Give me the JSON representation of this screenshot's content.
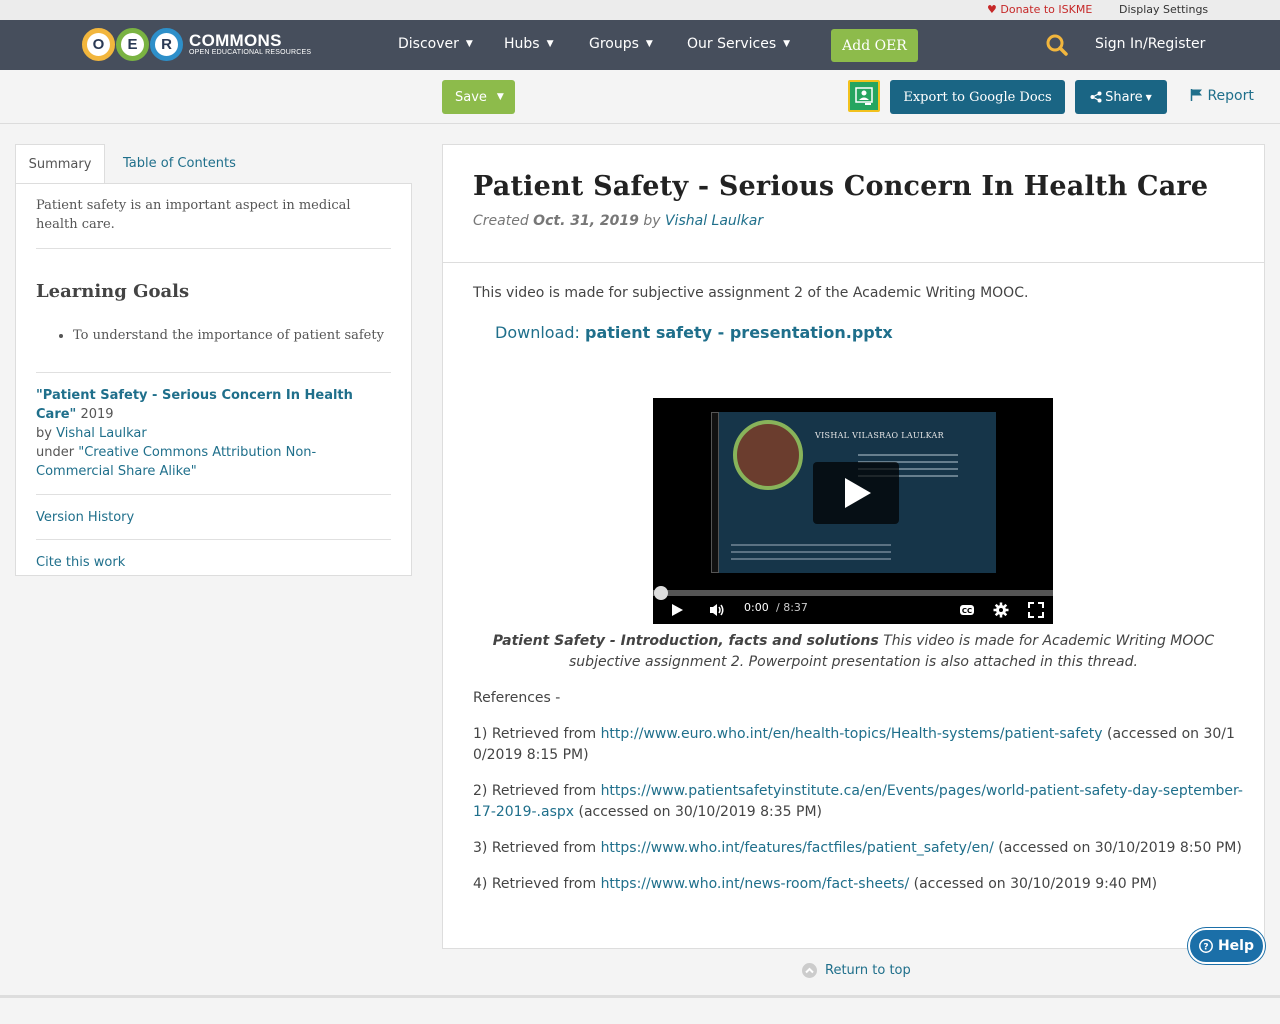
{
  "topbar": {
    "donate": "Donate to ISKME",
    "display_settings": "Display Settings"
  },
  "logo": {
    "letters": [
      "O",
      "E",
      "R"
    ],
    "name": "COMMONS",
    "tagline": "OPEN EDUCATIONAL RESOURCES"
  },
  "nav": {
    "items": [
      {
        "label": "Discover"
      },
      {
        "label": "Hubs"
      },
      {
        "label": "Groups"
      },
      {
        "label": "Our Services"
      }
    ],
    "add_oer": "Add OER",
    "sign_in": "Sign In/Register"
  },
  "toolbar": {
    "save": "Save",
    "export": "Export to Google Docs",
    "share": "Share",
    "report": "Report"
  },
  "sidebar": {
    "tabs": [
      "Summary",
      "Table of Contents"
    ],
    "summary": "Patient safety is an important aspect in medical health care.",
    "learning_goals_title": "Learning Goals",
    "learning_goals": [
      "To understand the importance of patient safety"
    ],
    "attribution": {
      "title": "\"Patient Safety - Serious Concern In Health Care\"",
      "year": "2019",
      "by": "by",
      "author": "Vishal Laulkar",
      "under": "under",
      "license": "\"Creative Commons Attribution Non-Commercial Share Alike\""
    },
    "version_history": "Version History",
    "cite": "Cite this work"
  },
  "main": {
    "title": "Patient Safety - Serious Concern In Health Care",
    "created_label": "Created",
    "created_date": "Oct. 31, 2019",
    "by": "by",
    "author": "Vishal Laulkar",
    "intro": "This video is made for subjective assignment 2 of the Academic Writing MOOC.",
    "download_label": "Download:",
    "download_file": "patient safety - presentation.pptx",
    "video": {
      "slide_name": "VISHAL VILASRAO LAULKAR",
      "time_current": "0:00",
      "time_total": "/ 8:37"
    },
    "caption_bold": "Patient Safety - Introduction, facts and solutions",
    "caption_rest": "This video is made for Academic Writing MOOC subjective assignment 2. Powerpoint presentation is also attached in this thread.",
    "references_title": "References -",
    "references": [
      {
        "prefix": "1) Retrieved from",
        "url": "http://www.euro.who.int/en/health-topics/Health-systems/patient-safety",
        "suffix": "(accessed on 30/10/2019 8:15 PM)"
      },
      {
        "prefix": "2) Retrieved from",
        "url": "https://www.patientsafetyinstitute.ca/en/Events/pages/world-patient-safety-day-september-17-2019-.aspx",
        "suffix": "(accessed on 30/10/2019 8:35 PM)"
      },
      {
        "prefix": "3) Retrieved from",
        "url": "https://www.who.int/features/factfiles/patient_safety/en/",
        "suffix": "(accessed on 30/10/2019 8:50 PM)"
      },
      {
        "prefix": "4) Retrieved from",
        "url": "https://www.who.int/news-room/fact-sheets/",
        "suffix": "(accessed on 30/10/2019 9:40 PM)"
      }
    ]
  },
  "return_to_top": "Return to top",
  "help": "Help",
  "colors": {
    "nav": "#464e5c",
    "green": "#8dbb4b",
    "blue": "#1a6584",
    "link": "#1f6f8b"
  }
}
